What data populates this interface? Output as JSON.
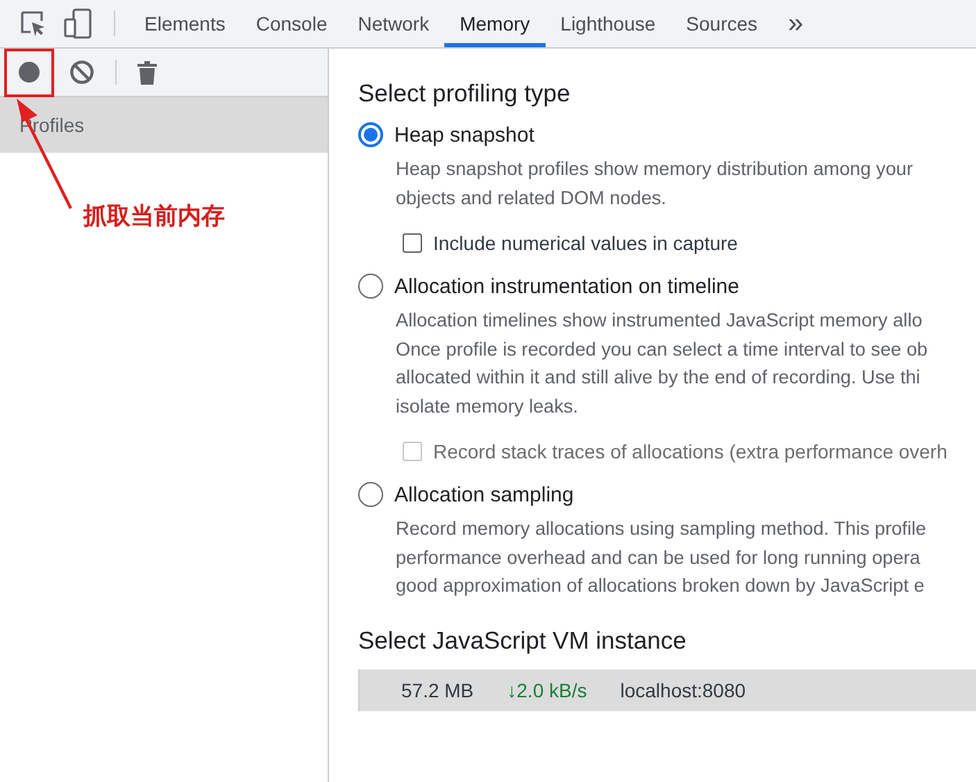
{
  "toolbar": {
    "tools": [
      {
        "kind": "inspect"
      },
      {
        "kind": "device"
      }
    ],
    "tabs": [
      {
        "label": "Elements",
        "selected": false
      },
      {
        "label": "Console",
        "selected": false
      },
      {
        "label": "Network",
        "selected": false
      },
      {
        "label": "Memory",
        "selected": true
      },
      {
        "label": "Lighthouse",
        "selected": false
      },
      {
        "label": "Sources",
        "selected": false
      }
    ],
    "more": "»"
  },
  "sidebar": {
    "actions": [
      {
        "kind": "record"
      },
      {
        "kind": "clear"
      },
      {
        "kind": "delete"
      }
    ],
    "items": [
      {
        "label": "Profiles",
        "selected": true
      }
    ]
  },
  "annotation": {
    "text": "抓取当前内存"
  },
  "profiling": {
    "heading": "Select profiling type",
    "options": [
      {
        "label": "Heap snapshot",
        "selected": true,
        "description": [
          "Heap snapshot profiles show memory distribution among your",
          "objects and related DOM nodes."
        ],
        "checkbox": {
          "label": "Include numerical values in capture",
          "checked": false,
          "disabled": false
        }
      },
      {
        "label": "Allocation instrumentation on timeline",
        "selected": false,
        "description": [
          "Allocation timelines show instrumented JavaScript memory allo",
          "Once profile is recorded you can select a time interval to see ob",
          "allocated within it and still alive by the end of recording. Use thi",
          "isolate memory leaks."
        ],
        "checkbox": {
          "label": "Record stack traces of allocations (extra performance overh",
          "checked": false,
          "disabled": true
        }
      },
      {
        "label": "Allocation sampling",
        "selected": false,
        "description": [
          "Record memory allocations using sampling method. This profile",
          "performance overhead and can be used for long running opera",
          "good approximation of allocations broken down by JavaScript e"
        ]
      }
    ]
  },
  "vm": {
    "heading": "Select JavaScript VM instance",
    "instances": [
      {
        "size": "57.2 MB",
        "rate": "↓2.0 kB/s",
        "host": "localhost:8080",
        "selected": true
      }
    ]
  }
}
